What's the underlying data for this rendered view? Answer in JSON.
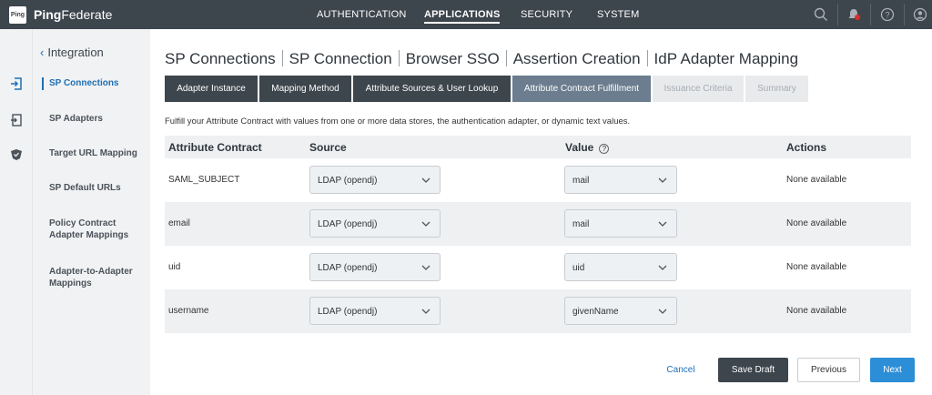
{
  "app": {
    "logo_text": "Ping",
    "brand_bold": "Ping",
    "brand_rest": "Federate"
  },
  "topnav": {
    "items": [
      {
        "label": "AUTHENTICATION"
      },
      {
        "label": "APPLICATIONS"
      },
      {
        "label": "SECURITY"
      },
      {
        "label": "SYSTEM"
      }
    ],
    "active": "APPLICATIONS",
    "icons": [
      "search-icon",
      "notification-bell-icon",
      "help-icon",
      "user-profile-icon"
    ]
  },
  "rail": {
    "icons": [
      "sp-connections-icon",
      "sp-adapters-icon",
      "security-shield-icon"
    ]
  },
  "sidebar": {
    "back_label": "Integration",
    "items": [
      {
        "label": "SP Connections",
        "active": true
      },
      {
        "label": "SP Adapters"
      },
      {
        "label": "Target URL Mapping"
      },
      {
        "label": "SP Default URLs"
      },
      {
        "label": "Policy Contract Adapter Mappings"
      },
      {
        "label": "Adapter-to-Adapter Mappings"
      }
    ]
  },
  "breadcrumb": [
    "SP Connections",
    "SP Connection",
    "Browser SSO",
    "Assertion Creation",
    "IdP Adapter Mapping"
  ],
  "tabs": [
    {
      "label": "Adapter Instance",
      "state": "done"
    },
    {
      "label": "Mapping Method",
      "state": "done"
    },
    {
      "label": "Attribute Sources & User Lookup",
      "state": "done"
    },
    {
      "label": "Attribute Contract Fulfillment",
      "state": "current"
    },
    {
      "label": "Issuance Criteria",
      "state": "disabled"
    },
    {
      "label": "Summary",
      "state": "disabled"
    }
  ],
  "description": "Fulfill your Attribute Contract with values from one or more data stores, the authentication adapter, or dynamic text values.",
  "table": {
    "headers": {
      "attribute": "Attribute Contract",
      "source": "Source",
      "value": "Value",
      "actions": "Actions"
    },
    "value_help_icon": "?",
    "rows": [
      {
        "attribute": "SAML_SUBJECT",
        "source": "LDAP (opendj)",
        "value": "mail",
        "actions": "None available"
      },
      {
        "attribute": "email",
        "source": "LDAP (opendj)",
        "value": "mail",
        "actions": "None available"
      },
      {
        "attribute": "uid",
        "source": "LDAP (opendj)",
        "value": "uid",
        "actions": "None available"
      },
      {
        "attribute": "username",
        "source": "LDAP (opendj)",
        "value": "givenName",
        "actions": "None available"
      }
    ]
  },
  "footer": {
    "cancel": "Cancel",
    "save_draft": "Save Draft",
    "previous": "Previous",
    "next": "Next"
  },
  "colors": {
    "topbar": "#3d454d",
    "accent": "#1e6fb5",
    "tab_current": "#6b7d8e",
    "next_button": "#2b8ed6"
  }
}
